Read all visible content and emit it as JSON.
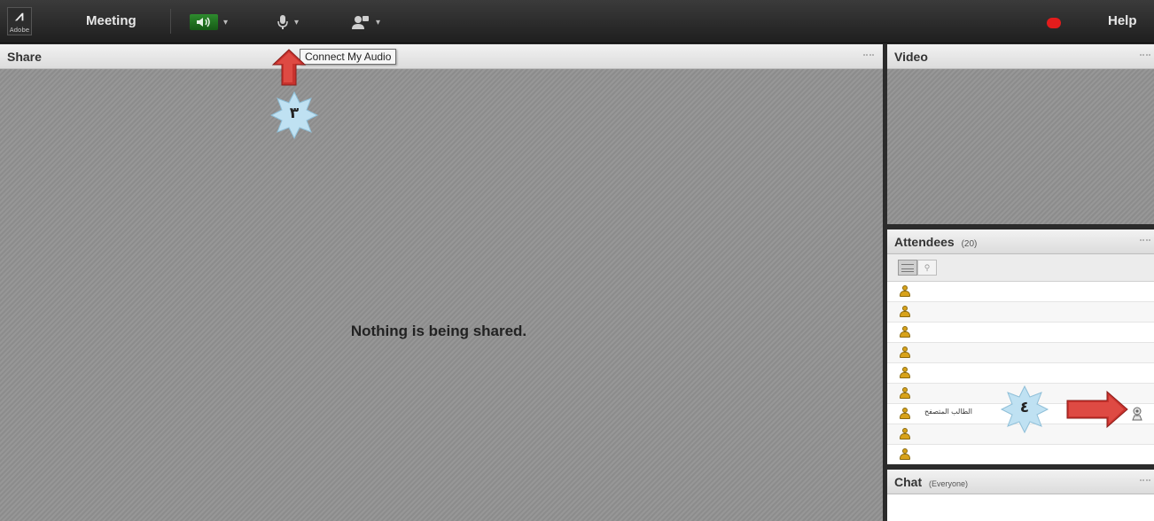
{
  "toolbar": {
    "logo_text": "Adobe",
    "meeting_label": "Meeting",
    "help_label": "Help",
    "icons": [
      "speaker-icon",
      "microphone-icon",
      "webcam-icon",
      "record-indicator-icon"
    ],
    "speaker_color": "#2e8b2e",
    "record_color": "#e21c1c"
  },
  "share_pod": {
    "title": "Share",
    "empty_message": "Nothing is being shared."
  },
  "tooltip": {
    "text": "Connect My Audio"
  },
  "video_pod": {
    "title": "Video"
  },
  "attendees_pod": {
    "title": "Attendees",
    "count": "(20)",
    "rows": [
      {
        "name": ""
      },
      {
        "name": ""
      },
      {
        "name": ""
      },
      {
        "name": ""
      },
      {
        "name": ""
      },
      {
        "name": ""
      },
      {
        "name": "الطالب المتصفح"
      },
      {
        "name": ""
      },
      {
        "name": ""
      },
      {
        "name": ""
      }
    ]
  },
  "chat_pod": {
    "title": "Chat",
    "scope": "(Everyone)"
  },
  "annotations": {
    "step_3": "٣",
    "step_4": "٤",
    "arrow_color": "#c8322d"
  }
}
